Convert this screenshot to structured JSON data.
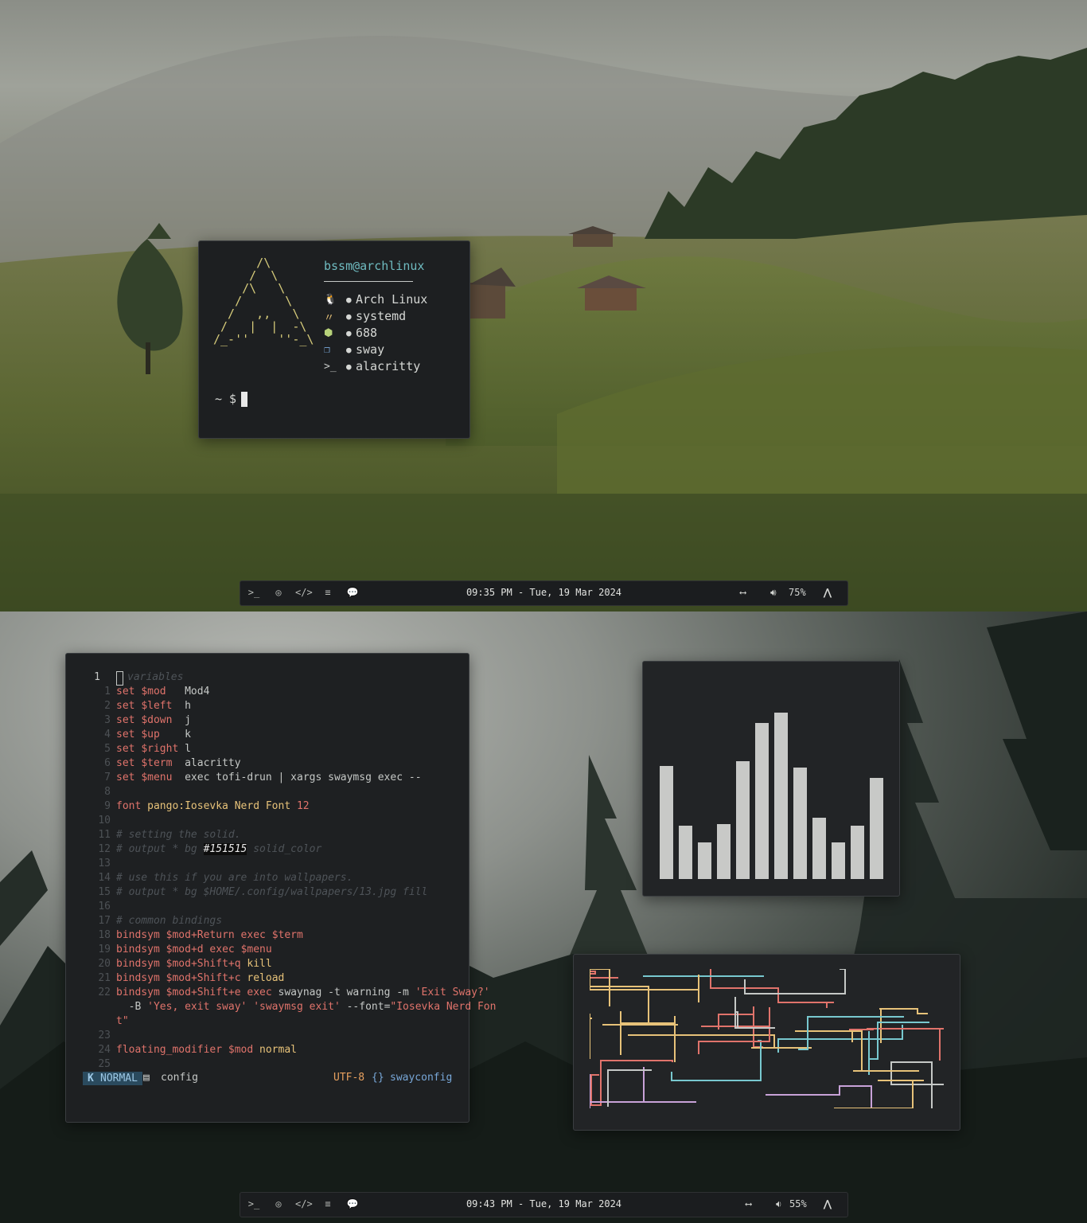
{
  "colors": {
    "pipe_pink": "#e0736b",
    "pipe_cyan": "#78c8cf",
    "pipe_yellow": "#e7c279",
    "pipe_purple": "#c8a2d8",
    "pipe_white": "#c5c8c6",
    "histogram": "#c8c9c7"
  },
  "top": {
    "fetch": {
      "art": "      /\\\n     /  \\\n    /\\   \\\n   /      \\\n  /   ,,   \\\n /   |  |  -\\\n/_-''    ''-_\\",
      "user": "bssm@archlinux",
      "rows": [
        {
          "icon": "tux-icon",
          "glyph": "🐧",
          "color": "#e0736b",
          "value": "Arch Linux"
        },
        {
          "icon": "init-icon",
          "glyph": "〃",
          "color": "#e7c279",
          "value": "systemd"
        },
        {
          "icon": "package-icon",
          "glyph": "⬢",
          "color": "#b7d27a",
          "value": "688"
        },
        {
          "icon": "window-manager-icon",
          "glyph": "❐",
          "color": "#78a7d8",
          "value": "sway"
        },
        {
          "icon": "terminal-icon",
          "glyph": ">_",
          "color": "#c5c8c6",
          "value": "alacritty"
        }
      ],
      "prompt": "~ $"
    },
    "bar": {
      "clock": "09:35 PM - Tue, 19 Mar 2024",
      "volume": "75%"
    }
  },
  "bottom": {
    "editor": {
      "lines": [
        {
          "n": "1",
          "tokens": [
            [
              "cm",
              "variables"
            ]
          ]
        },
        {
          "n": "1",
          "tokens": [
            [
              "kw",
              "set "
            ],
            [
              "var",
              "$mod"
            ],
            [
              "t",
              "   Mod4"
            ]
          ]
        },
        {
          "n": "2",
          "tokens": [
            [
              "kw",
              "set "
            ],
            [
              "var",
              "$left"
            ],
            [
              "t",
              "  h"
            ]
          ]
        },
        {
          "n": "3",
          "tokens": [
            [
              "kw",
              "set "
            ],
            [
              "var",
              "$down"
            ],
            [
              "t",
              "  j"
            ]
          ]
        },
        {
          "n": "4",
          "tokens": [
            [
              "kw",
              "set "
            ],
            [
              "var",
              "$up"
            ],
            [
              "t",
              "    k"
            ]
          ]
        },
        {
          "n": "5",
          "tokens": [
            [
              "kw",
              "set "
            ],
            [
              "var",
              "$right"
            ],
            [
              "t",
              " l"
            ]
          ]
        },
        {
          "n": "6",
          "tokens": [
            [
              "kw",
              "set "
            ],
            [
              "var",
              "$term"
            ],
            [
              "t",
              "  alacritty"
            ]
          ]
        },
        {
          "n": "7",
          "tokens": [
            [
              "kw",
              "set "
            ],
            [
              "var",
              "$menu"
            ],
            [
              "t",
              "  exec tofi-drun | xargs swaymsg exec --"
            ]
          ]
        },
        {
          "n": "8",
          "tokens": []
        },
        {
          "n": "9",
          "tokens": [
            [
              "kw",
              "font "
            ],
            [
              "yl",
              "pango:Iosevka Nerd Font "
            ],
            [
              "num",
              "12"
            ]
          ]
        },
        {
          "n": "10",
          "tokens": []
        },
        {
          "n": "11",
          "tokens": [
            [
              "cm",
              "# setting the solid."
            ]
          ]
        },
        {
          "n": "12",
          "tokens": [
            [
              "cm",
              "# output * bg "
            ],
            [
              "hl",
              "#151515"
            ],
            [
              "cm",
              " solid_color"
            ]
          ]
        },
        {
          "n": "13",
          "tokens": []
        },
        {
          "n": "14",
          "tokens": [
            [
              "cm",
              "# use this if you are into wallpapers."
            ]
          ]
        },
        {
          "n": "15",
          "tokens": [
            [
              "cm",
              "# output * bg $HOME/.config/wallpapers/13.jpg fill"
            ]
          ]
        },
        {
          "n": "16",
          "tokens": []
        },
        {
          "n": "17",
          "tokens": [
            [
              "cm",
              "# common bindings"
            ]
          ]
        },
        {
          "n": "18",
          "tokens": [
            [
              "kw",
              "bindsym "
            ],
            [
              "var",
              "$mod"
            ],
            [
              "kw",
              "+Return exec "
            ],
            [
              "var",
              "$term"
            ]
          ]
        },
        {
          "n": "19",
          "tokens": [
            [
              "kw",
              "bindsym "
            ],
            [
              "var",
              "$mod"
            ],
            [
              "kw",
              "+d exec "
            ],
            [
              "var",
              "$menu"
            ]
          ]
        },
        {
          "n": "20",
          "tokens": [
            [
              "kw",
              "bindsym "
            ],
            [
              "var",
              "$mod"
            ],
            [
              "kw",
              "+Shift+q "
            ],
            [
              "yl",
              "kill"
            ]
          ]
        },
        {
          "n": "21",
          "tokens": [
            [
              "kw",
              "bindsym "
            ],
            [
              "var",
              "$mod"
            ],
            [
              "kw",
              "+Shift+c "
            ],
            [
              "yl",
              "reload"
            ]
          ]
        },
        {
          "n": "22",
          "tokens": [
            [
              "kw",
              "bindsym "
            ],
            [
              "var",
              "$mod"
            ],
            [
              "kw",
              "+Shift+e exec "
            ],
            [
              "t",
              "swaynag -t warning -m "
            ],
            [
              "str",
              "'Exit Sway?'"
            ]
          ]
        },
        {
          "n": "",
          "tokens": [
            [
              "t",
              "  -B "
            ],
            [
              "str",
              "'Yes, exit sway'"
            ],
            [
              "t",
              " "
            ],
            [
              "str",
              "'swaymsg exit'"
            ],
            [
              "t",
              " --font="
            ],
            [
              "str",
              "\"Iosevka Nerd Fon"
            ]
          ]
        },
        {
          "n": "",
          "tokens": [
            [
              "str",
              "t\""
            ]
          ]
        },
        {
          "n": "23",
          "tokens": []
        },
        {
          "n": "24",
          "tokens": [
            [
              "kw",
              "floating_modifier "
            ],
            [
              "var",
              "$mod"
            ],
            [
              "yl",
              " normal"
            ]
          ]
        },
        {
          "n": "25",
          "tokens": []
        }
      ],
      "status": {
        "mode": "NORMAL",
        "file": "config",
        "encoding": "UTF-8",
        "filetype": "swayconfig"
      }
    },
    "histogram": {
      "values": [
        0.68,
        0.32,
        0.22,
        0.33,
        0.71,
        0.94,
        1.0,
        0.67,
        0.37,
        0.22,
        0.32,
        0.61
      ]
    },
    "bar": {
      "clock": "09:43 PM - Tue, 19 Mar 2024",
      "volume": "55%"
    }
  },
  "bar_icons": [
    "terminal-icon",
    "chrome-icon",
    "code-icon",
    "spotify-icon",
    "chat-icon"
  ]
}
